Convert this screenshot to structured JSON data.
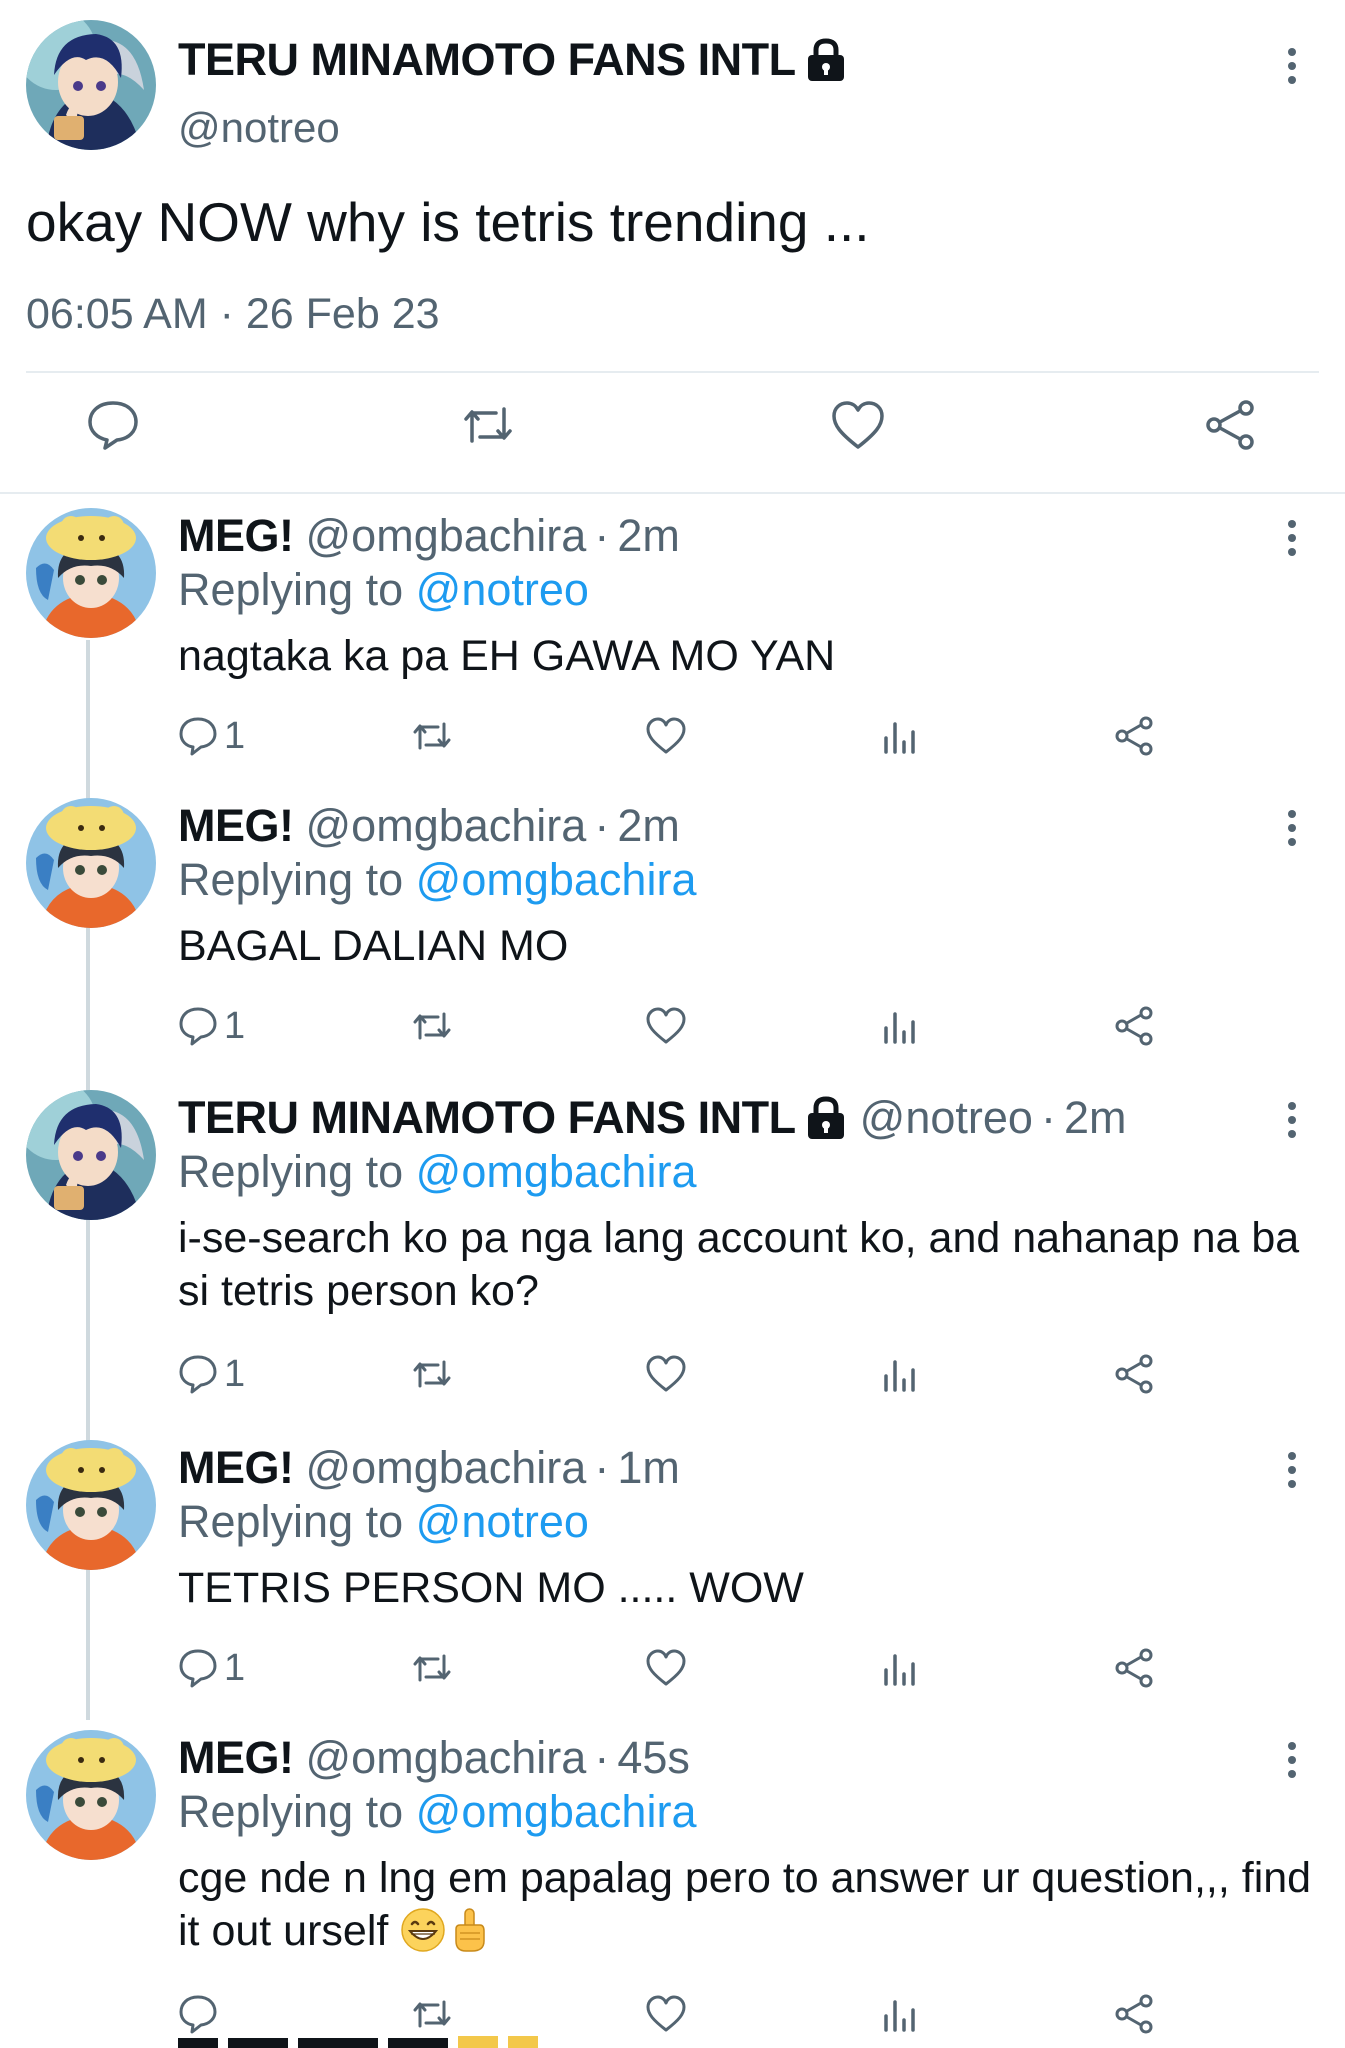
{
  "colors": {
    "link": "#1d9bf0",
    "secondary": "#536471",
    "text": "#0f1419",
    "divider": "#e6ecf0"
  },
  "main_tweet": {
    "display_name": "TERU MINAMOTO FANS INTL",
    "handle": "@notreo",
    "text": "okay NOW why is tetris trending ...",
    "timestamp": "06:05 AM · 26 Feb 23",
    "icons": [
      "lock-icon",
      "more-icon",
      "reply-icon",
      "retweet-icon",
      "like-icon",
      "share-icon"
    ]
  },
  "replies": [
    {
      "display_name": "MEG!",
      "handle": "@omgbachira",
      "dot": "·",
      "time": "2m",
      "replying_prefix": "Replying to",
      "replying_to": "@notreo",
      "text": "nagtaka ka pa EH GAWA MO YAN",
      "reply_count": "1"
    },
    {
      "display_name": "MEG!",
      "handle": "@omgbachira",
      "dot": "·",
      "time": "2m",
      "replying_prefix": "Replying to",
      "replying_to": "@omgbachira",
      "text": "BAGAL DALIAN MO",
      "reply_count": "1"
    },
    {
      "display_name": "TERU MINAMOTO FANS INTL",
      "handle": "@notreo",
      "dot": "·",
      "time": "2m",
      "replying_prefix": "Replying to",
      "replying_to": "@omgbachira",
      "text": "i-se-search ko pa nga lang account ko, and nahanap na ba si tetris person ko?",
      "reply_count": "1"
    },
    {
      "display_name": "MEG!",
      "handle": "@omgbachira",
      "dot": "·",
      "time": "1m",
      "replying_prefix": "Replying to",
      "replying_to": "@notreo",
      "text": "TETRIS PERSON MO ..... WOW",
      "reply_count": "1"
    },
    {
      "display_name": "MEG!",
      "handle": "@omgbachira",
      "dot": "·",
      "time": "45s",
      "replying_prefix": "Replying to",
      "replying_to": "@omgbachira",
      "text": "cge nde n lng em papalag pero to answer ur question,,, find it out urself",
      "emojis": [
        "grinning-face-emoji",
        "pointing-up-emoji"
      ],
      "reply_count": ""
    }
  ]
}
